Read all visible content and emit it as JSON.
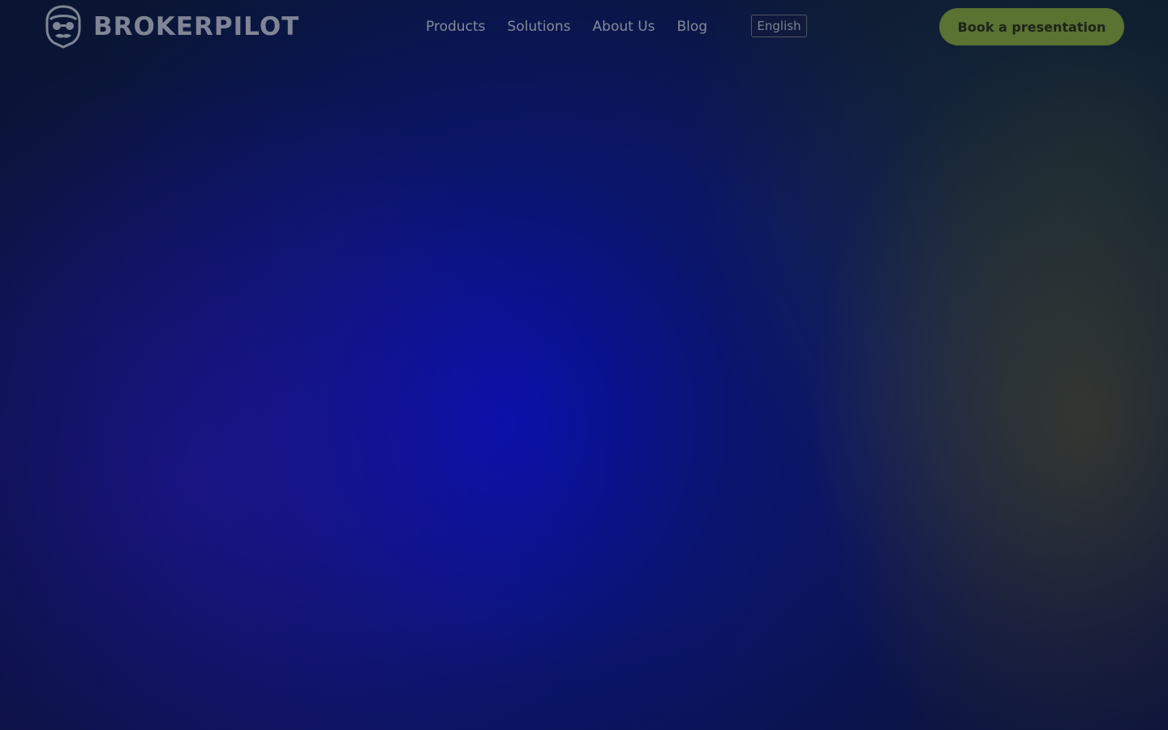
{
  "header": {
    "logo": {
      "icon": "pilot-face-icon",
      "text": "BROKERPILOT"
    },
    "nav": [
      {
        "label": "Products"
      },
      {
        "label": "Solutions"
      },
      {
        "label": "About Us"
      },
      {
        "label": "Blog"
      }
    ],
    "language": {
      "selected": "English"
    },
    "cta": {
      "label": "Book a presentation"
    }
  },
  "colors": {
    "background_center": "#0a14a8",
    "background_edge": "#0c1a3c",
    "accent_glow": "#5f5a23",
    "cta_background": "#5a7232",
    "nav_text": "#848a9c"
  }
}
